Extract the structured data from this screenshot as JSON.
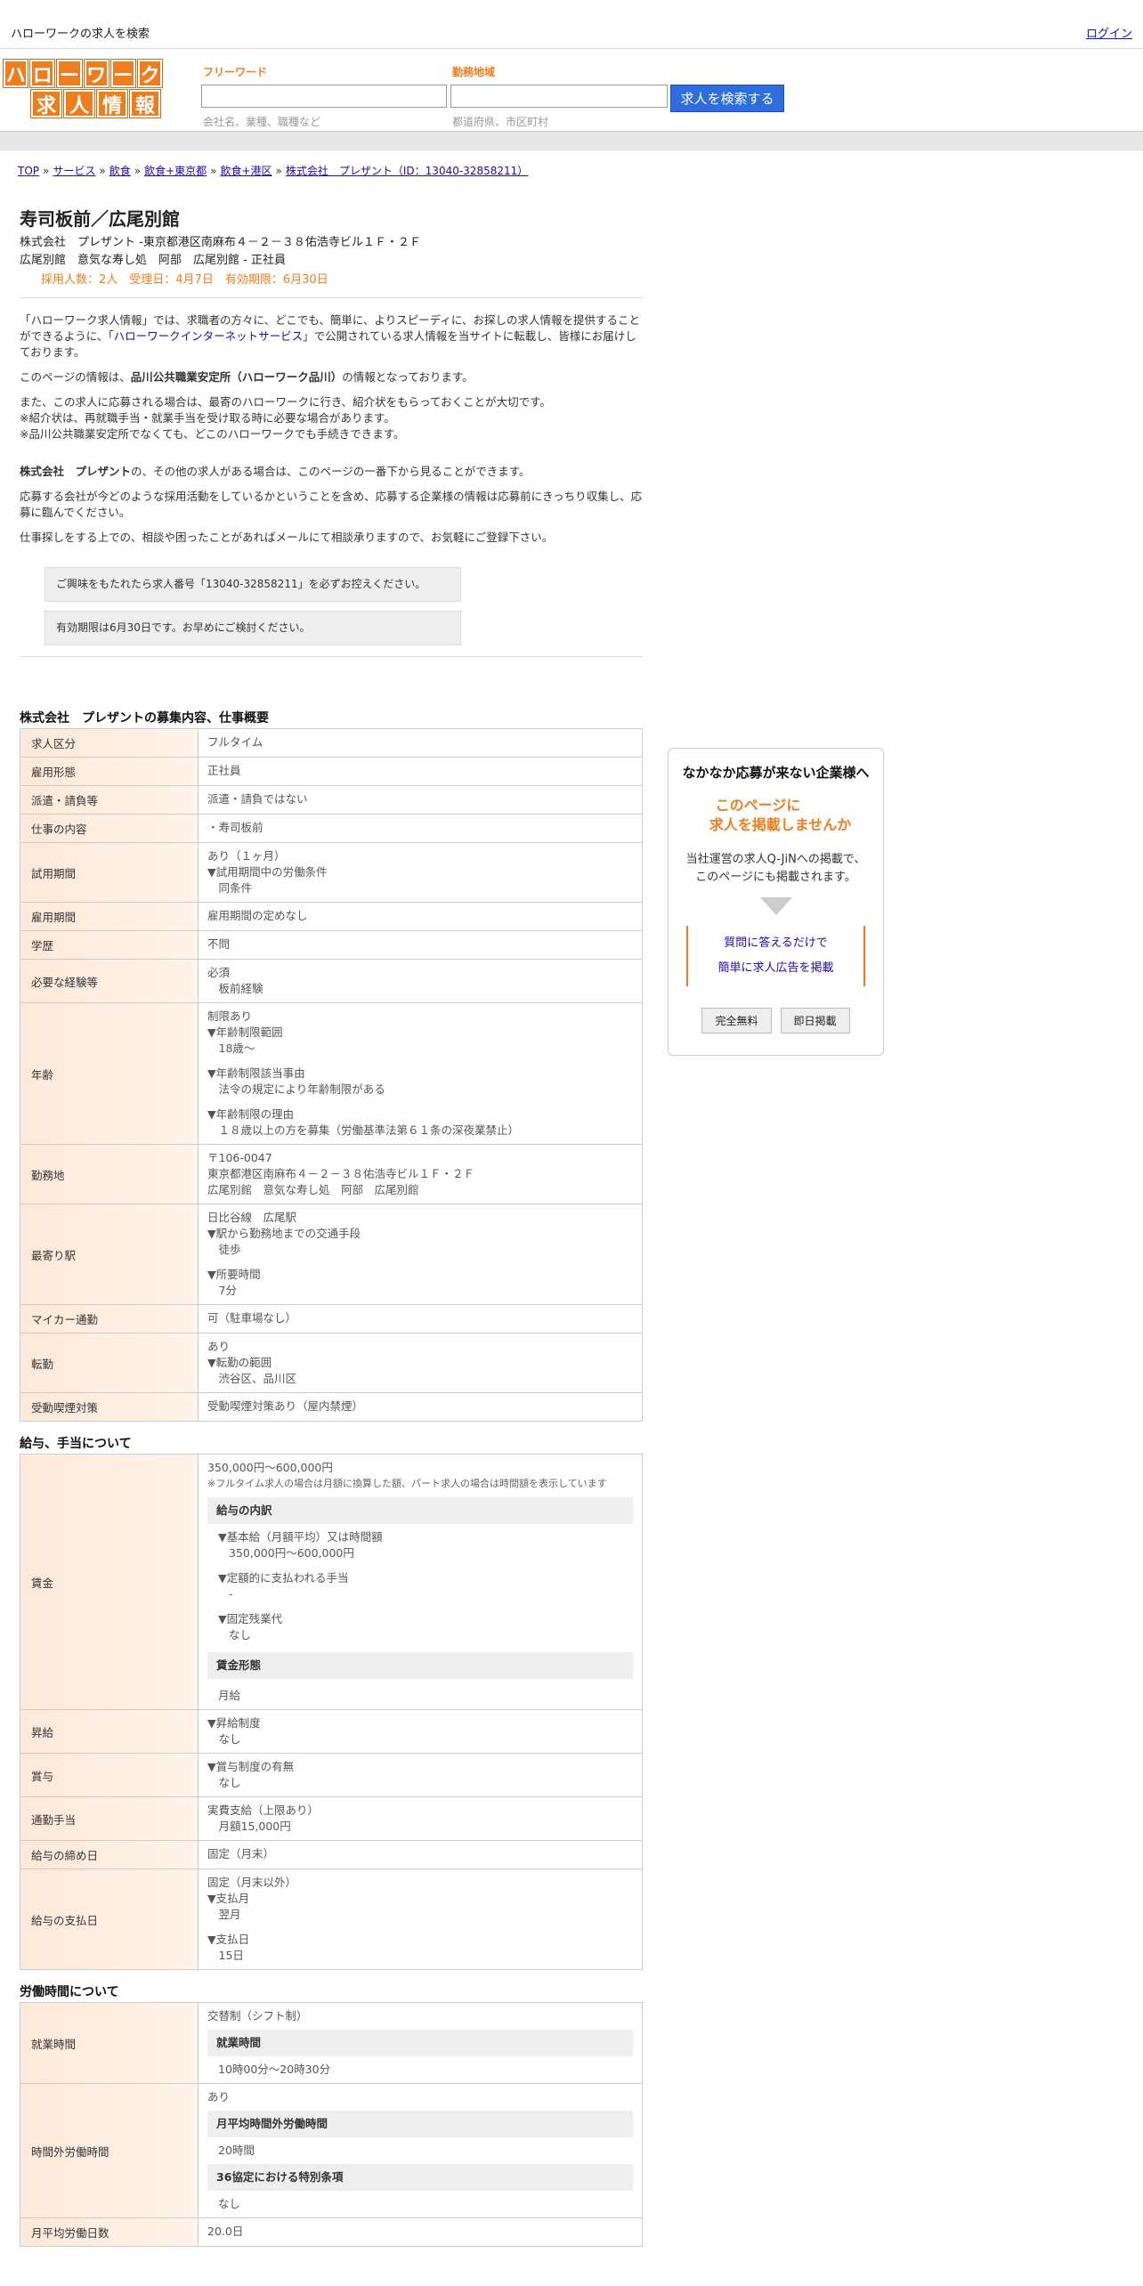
{
  "topbar": {
    "site_title": "ハローワークの求人を検索",
    "login": "ログイン"
  },
  "header": {
    "logo_row1": [
      "ハ",
      "ロ",
      "ー",
      "ワ",
      "ー",
      "ク"
    ],
    "logo_row2": [
      "求",
      "人",
      "情",
      "報"
    ],
    "freeword_label": "フリーワード",
    "freeword_hint": "会社名、業種、職種など",
    "area_label": "勤務地域",
    "area_hint": "都道府県、市区町村",
    "search_button": "求人を検索する"
  },
  "breadcrumb": [
    "TOP",
    "サービス",
    "飲食",
    "飲食+東京都",
    "飲食+港区",
    "株式会社　プレザント（ID：13040-32858211）"
  ],
  "job": {
    "title": "寿司板前／広尾別館",
    "line1": "株式会社　プレザント -東京都港区南麻布４－２－３８佑浩寺ビル１Ｆ・２Ｆ",
    "line2": "広尾別館　意気な寿し処　阿部　広尾別館 - 正社員",
    "line3": "採用人数：2人　受理日：4月7日　有効期限：6月30日"
  },
  "intro": {
    "p1a": "「ハローワーク求人情報」では、求職者の方々に、どこでも、簡単に、よりスピーディに、お探しの求人情報を提供することができるように、「",
    "p1link": "ハローワークインターネットサービス",
    "p1b": "」で公開されている求人情報を当サイトに転載し、皆様にお届けしております。",
    "p2a": "このページの情報は、",
    "p2bold": "品川公共職業安定所（ハローワーク品川）",
    "p2b": "の情報となっております。",
    "p3": "また、この求人に応募される場合は、最寄のハローワークに行き、紹介状をもらっておくことが大切です。",
    "p3b": "※紹介状は、再就職手当・就業手当を受け取る時に必要な場合があります。",
    "p3c": "※品川公共職業安定所でなくても、どこのハローワークでも手続きできます。",
    "p4bold": "株式会社　プレザント",
    "p4": "の、その他の求人がある場合は、このページの一番下から見ることができます。",
    "p5": "応募する会社が今どのような採用活動をしているかということを含め、応募する企業様の情報は応募前にきっちり収集し、応募に臨んでください。",
    "p6": "仕事探しをする上での、相談や困ったことがあればメールにて相談承りますので、お気軽にご登録下さい。",
    "notice1": "ご興味をもたれたら求人番号「13040-32858211」を必ずお控えください。",
    "notice2": "有効期限は6月30日です。お早めにご検討ください。"
  },
  "sec1": {
    "title": "株式会社　プレザントの募集内容、仕事概要",
    "rows": [
      {
        "h": "求人区分",
        "v": [
          "フルタイム"
        ]
      },
      {
        "h": "雇用形態",
        "v": [
          "正社員"
        ]
      },
      {
        "h": "派遣・請負等",
        "v": [
          "派遣・請負ではない"
        ]
      },
      {
        "h": "仕事の内容",
        "v": [
          "・寿司板前"
        ]
      },
      {
        "h": "試用期間",
        "v": [
          "あり（１ヶ月）",
          " ▼試用期間中の労働条件",
          "　同条件"
        ]
      },
      {
        "h": "雇用期間",
        "v": [
          "雇用期間の定めなし"
        ]
      },
      {
        "h": "学歴",
        "v": [
          "不問"
        ]
      },
      {
        "h": "必要な経験等",
        "v": [
          "必須",
          "　板前経験"
        ]
      },
      {
        "h": "年齢",
        "v": [
          "制限あり",
          " ▼年齢制限範囲",
          "　18歳〜",
          "",
          " ▼年齢制限該当事由",
          "　法令の規定により年齢制限がある",
          "",
          " ▼年齢制限の理由",
          "　１８歳以上の方を募集（労働基準法第６１条の深夜業禁止）"
        ]
      },
      {
        "h": "勤務地",
        "v": [
          "〒106-0047",
          "東京都港区南麻布４－２－３８佑浩寺ビル１Ｆ・２Ｆ",
          "広尾別館　意気な寿し処　阿部　広尾別館"
        ]
      },
      {
        "h": "最寄り駅",
        "v": [
          "日比谷線　広尾駅",
          " ▼駅から勤務地までの交通手段",
          "　徒歩",
          "",
          " ▼所要時間",
          "　7分"
        ]
      },
      {
        "h": "マイカー通勤",
        "v": [
          "可（駐車場なし）"
        ]
      },
      {
        "h": "転勤",
        "v": [
          "あり",
          " ▼転勤の範囲",
          "　渋谷区、品川区"
        ]
      },
      {
        "h": "受動喫煙対策",
        "v": [
          "受動喫煙対策あり（屋内禁煙）"
        ]
      }
    ]
  },
  "sec2": {
    "title": "給与、手当について",
    "wage_h": "賃金",
    "wage_range": "350,000円〜600,000円",
    "wage_note": "※フルタイム求人の場合は月額に換算した額、パート求人の場合は時間額を表示しています",
    "wage_sub1": "給与の内訳",
    "wage_b1": "▼基本給（月額平均）又は時間額",
    "wage_b1v": "350,000円〜600,000円",
    "wage_b2": "▼定額的に支払われる手当",
    "wage_b2v": "-",
    "wage_b3": "▼固定残業代",
    "wage_b3v": "なし",
    "wage_sub2": "賃金形態",
    "wage_form": "月給",
    "rows": [
      {
        "h": "昇給",
        "v": [
          "▼昇給制度",
          "　なし"
        ]
      },
      {
        "h": "賞与",
        "v": [
          "▼賞与制度の有無",
          "　なし"
        ]
      },
      {
        "h": "通勤手当",
        "v": [
          "実費支給（上限あり）",
          "　月額15,000円"
        ]
      },
      {
        "h": "給与の締め日",
        "v": [
          "固定（月末）"
        ]
      },
      {
        "h": "給与の支払日",
        "v": [
          "固定（月末以外）",
          "▼支払月",
          "　翌月",
          "",
          "▼支払日",
          "　15日"
        ]
      }
    ]
  },
  "sec3": {
    "title": "労働時間について",
    "work_h": "就業時間",
    "work_v": "交替制（シフト制）",
    "work_sub": "就業時間",
    "work_time": "10時00分〜20時30分",
    "ot_h": "時間外労働時間",
    "ot_v": "あり",
    "ot_sub1": "月平均時間外労働時間",
    "ot_v1": "20時間",
    "ot_sub2": "36協定における特別条項",
    "ot_v2": "なし",
    "days_h": "月平均労働日数",
    "days_v": "20.0日"
  },
  "ad": {
    "title": "なかなか応募が来ない企業様へ",
    "catch1": "このページに",
    "catch2": "求人を掲載しませんか",
    "desc1": "当社運営の求人Q-JiNへの掲載で、",
    "desc2": "このページにも掲載されます。",
    "link1": "質問に答えるだけで",
    "link2": "簡単に求人広告を掲載",
    "btn1": "完全無料",
    "btn2": "即日掲載"
  }
}
